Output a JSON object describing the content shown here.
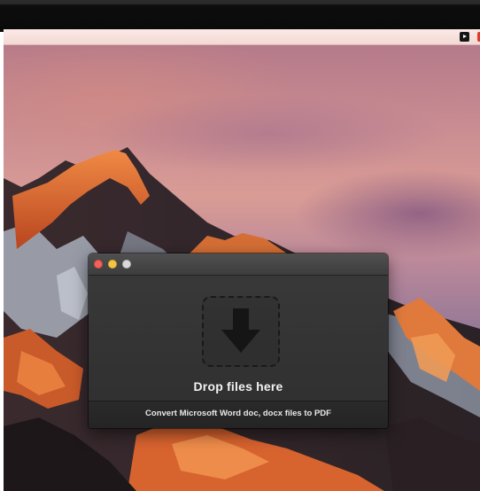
{
  "app": {
    "drop_label": "Drop files here",
    "footer_label": "Convert Microsoft Word doc, docx files to PDF",
    "icons": {
      "drop": "download-arrow-icon",
      "close": "close-button-red",
      "minimize": "minimize-button-yellow",
      "zoom": "zoom-button-gray"
    }
  },
  "menubar": {
    "icons": [
      "play-icon",
      "red-status-icon"
    ]
  },
  "desktop": {
    "wallpaper": "mountain-sunset-wallpaper"
  },
  "colors": {
    "window_bg": "#333333",
    "titlebar": "#474747",
    "close": "#f1625a",
    "minimize": "#f6c544",
    "zoom": "#d9d9d9",
    "sky_top": "#b57a8a",
    "peak_orange": "#d7632f"
  }
}
